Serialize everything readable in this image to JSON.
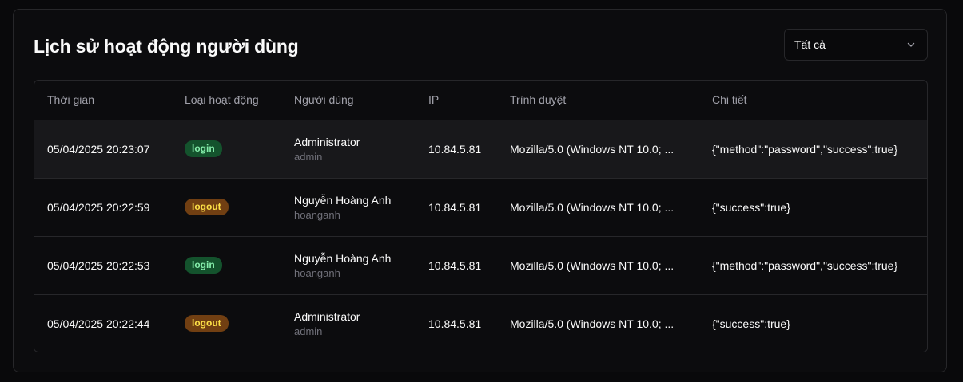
{
  "page": {
    "title": "Lịch sử hoạt động người dùng"
  },
  "filter": {
    "value": "Tất cả"
  },
  "colors": {
    "login_bg": "#14532d",
    "login_fg": "#86efac",
    "logout_bg": "#713f12",
    "logout_fg": "#fde047"
  },
  "table": {
    "headers": [
      "Thời gian",
      "Loại hoạt động",
      "Người dùng",
      "IP",
      "Trình duyệt",
      "Chi tiết"
    ],
    "rows": [
      {
        "time": "05/04/2025 20:23:07",
        "type": "login",
        "name": "Administrator",
        "username": "admin",
        "ip": "10.84.5.81",
        "browser": "Mozilla/5.0 (Windows NT 10.0; ...",
        "details": "{\"method\":\"password\",\"success\":true}"
      },
      {
        "time": "05/04/2025 20:22:59",
        "type": "logout",
        "name": "Nguyễn Hoàng Anh",
        "username": "hoanganh",
        "ip": "10.84.5.81",
        "browser": "Mozilla/5.0 (Windows NT 10.0; ...",
        "details": "{\"success\":true}"
      },
      {
        "time": "05/04/2025 20:22:53",
        "type": "login",
        "name": "Nguyễn Hoàng Anh",
        "username": "hoanganh",
        "ip": "10.84.5.81",
        "browser": "Mozilla/5.0 (Windows NT 10.0; ...",
        "details": "{\"method\":\"password\",\"success\":true}"
      },
      {
        "time": "05/04/2025 20:22:44",
        "type": "logout",
        "name": "Administrator",
        "username": "admin",
        "ip": "10.84.5.81",
        "browser": "Mozilla/5.0 (Windows NT 10.0; ...",
        "details": "{\"success\":true}"
      }
    ]
  }
}
